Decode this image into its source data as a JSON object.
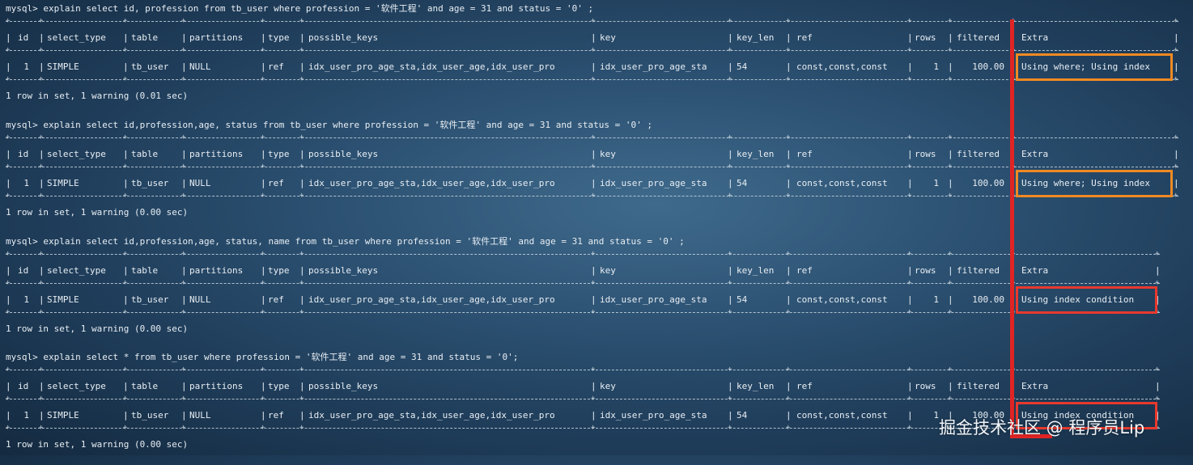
{
  "queries": [
    {
      "command": "mysql> explain select id, profession from tb_user where profession = '软件工程' and age = 31 and status = '0' ;",
      "headers": [
        "id",
        "select_type",
        "table",
        "partitions",
        "type",
        "possible_keys",
        "key",
        "key_len",
        "ref",
        "rows",
        "filtered",
        "Extra"
      ],
      "row": [
        "1",
        "SIMPLE",
        "tb_user",
        "NULL",
        "ref",
        "idx_user_pro_age_sta,idx_user_age,idx_user_pro",
        "idx_user_pro_age_sta",
        "54",
        "const,const,const",
        "1",
        "100.00",
        "Using where; Using index"
      ],
      "summary": "1 row in set, 1 warning (0.01 sec)",
      "highlight": "orange"
    },
    {
      "command": "mysql> explain select id,profession,age, status from tb_user where profession = '软件工程' and age = 31 and status = '0' ;",
      "headers": [
        "id",
        "select_type",
        "table",
        "partitions",
        "type",
        "possible_keys",
        "key",
        "key_len",
        "ref",
        "rows",
        "filtered",
        "Extra"
      ],
      "row": [
        "1",
        "SIMPLE",
        "tb_user",
        "NULL",
        "ref",
        "idx_user_pro_age_sta,idx_user_age,idx_user_pro",
        "idx_user_pro_age_sta",
        "54",
        "const,const,const",
        "1",
        "100.00",
        "Using where; Using index"
      ],
      "summary": "1 row in set, 1 warning (0.00 sec)",
      "highlight": "orange"
    },
    {
      "command": "mysql> explain select id,profession,age, status, name from tb_user where profession = '软件工程' and age = 31 and status = '0' ;",
      "headers": [
        "id",
        "select_type",
        "table",
        "partitions",
        "type",
        "possible_keys",
        "key",
        "key_len",
        "ref",
        "rows",
        "filtered",
        "Extra"
      ],
      "row": [
        "1",
        "SIMPLE",
        "tb_user",
        "NULL",
        "ref",
        "idx_user_pro_age_sta,idx_user_age,idx_user_pro",
        "idx_user_pro_age_sta",
        "54",
        "const,const,const",
        "1",
        "100.00",
        "Using index condition"
      ],
      "summary": "1 row in set, 1 warning (0.00 sec)",
      "highlight": "red"
    },
    {
      "command": "mysql> explain select * from tb_user where profession = '软件工程' and age = 31 and status = '0';",
      "headers": [
        "id",
        "select_type",
        "table",
        "partitions",
        "type",
        "possible_keys",
        "key",
        "key_len",
        "ref",
        "rows",
        "filtered",
        "Extra"
      ],
      "row": [
        "1",
        "SIMPLE",
        "tb_user",
        "NULL",
        "ref",
        "idx_user_pro_age_sta,idx_user_age,idx_user_pro",
        "idx_user_pro_age_sta",
        "54",
        "const,const,const",
        "1",
        "100.00",
        "Using index condition"
      ],
      "summary": "1 row in set, 1 warning (0.00 sec)",
      "highlight": "red"
    }
  ],
  "watermark": "掘金技术社区 @ 程序员Lip",
  "colors": {
    "orange_box": "#f08a23",
    "red_box": "#e8392e",
    "red_line": "#e02424",
    "text": "#e8eef3"
  }
}
